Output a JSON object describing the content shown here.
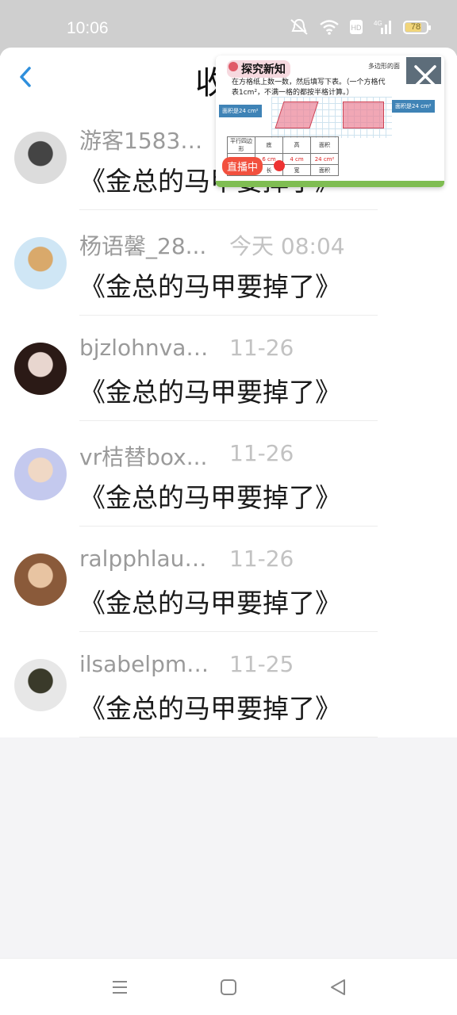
{
  "status_bar": {
    "time": "10:06",
    "battery_percent": "78",
    "battery_level": 0.78,
    "icons": [
      "mute-icon",
      "wifi-icon",
      "hd-icon",
      "signal-icon",
      "battery-icon"
    ]
  },
  "header": {
    "title": "收",
    "back_icon": "back-arrow-icon"
  },
  "messages": [
    {
      "name": "游客15836...",
      "time": "",
      "text": "《金总的马甲要掉了》",
      "avatar_colors": [
        "#dcdcdc",
        "#444"
      ]
    },
    {
      "name": "杨语馨_28...",
      "time": "今天 08:04",
      "text": "《金总的马甲要掉了》",
      "avatar_colors": [
        "#cfe6f5",
        "#d9a96b"
      ]
    },
    {
      "name": "bjzlohnvar...",
      "time": "11-26",
      "text": "《金总的马甲要掉了》",
      "avatar_colors": [
        "#2b1a16",
        "#e8d6cf"
      ]
    },
    {
      "name": "vr桔替box...",
      "time": "11-26",
      "text": "《金总的马甲要掉了》",
      "avatar_colors": [
        "#c4c9ee",
        "#f0d8c5"
      ]
    },
    {
      "name": "ralpphlauw...",
      "time": "11-26",
      "text": "《金总的马甲要掉了》",
      "avatar_colors": [
        "#8a5a3a",
        "#e8c4a2"
      ]
    },
    {
      "name": "ilsabelpma...",
      "time": "11-25",
      "text": "《金总的马甲要掉了》",
      "avatar_colors": [
        "#e7e7e7",
        "#3a3a2a"
      ]
    }
  ],
  "live_overlay": {
    "lesson_title": "探究新知",
    "caption": "多边形的面",
    "instruction_line1": "在方格纸上数一数，然后填写下表。（一个方格代",
    "instruction_line2": "表1cm²，不满一格的都按半格计算。）",
    "note_left": "面积是24 cm²",
    "note_right": "面积是24 cm²",
    "table": [
      [
        "平行四边形",
        "底",
        "高",
        "面积"
      ],
      [
        "",
        "6 cm",
        "4 cm",
        "24 cm²"
      ],
      [
        "",
        "长",
        "宽",
        "面积"
      ]
    ],
    "live_badge": "直播中",
    "close_icon": "close-icon"
  },
  "nav_bar": {
    "buttons": [
      "menu-icon",
      "home-icon",
      "back-triangle-icon"
    ]
  },
  "colors": {
    "accent": "#2f8fdc",
    "live_badge": "#f2503e"
  }
}
